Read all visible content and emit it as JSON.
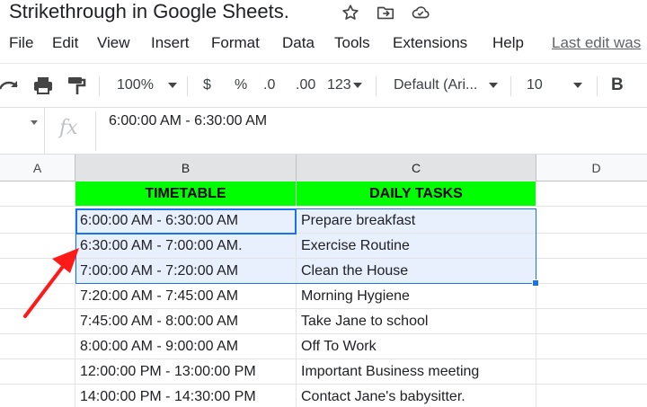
{
  "title": {
    "text": "Strikethrough in Google Sheets.",
    "icons": [
      "star-icon",
      "move-to-folder-icon",
      "cloud-saved-icon"
    ]
  },
  "menu": {
    "items": [
      "File",
      "Edit",
      "View",
      "Insert",
      "Format",
      "Data",
      "Tools",
      "Extensions",
      "Help"
    ],
    "last_edit": "Last edit was"
  },
  "toolbar": {
    "zoom": "100%",
    "currency": "$",
    "percent": "%",
    "decrease_decimal": ".0",
    "increase_decimal": ".00",
    "more_formats": "123",
    "font": "Default (Ari...",
    "font_size": "10",
    "bold": "B"
  },
  "formula_bar": {
    "fx": "fx",
    "value": "6:00:00 AM - 6:30:00 AM"
  },
  "columns": [
    "A",
    "B",
    "C",
    "D"
  ],
  "sheet": {
    "header": {
      "b": "TIMETABLE",
      "c": "DAILY TASKS"
    },
    "rows": [
      {
        "b": "6:00:00 AM - 6:30:00 AM",
        "c": "Prepare breakfast"
      },
      {
        "b": "6:30:00 AM - 7:00:00 AM.",
        "c": "Exercise Routine"
      },
      {
        "b": "7:00:00 AM - 7:20:00 AM",
        "c": "Clean the House"
      },
      {
        "b": "7:20:00 AM - 7:45:00 AM",
        "c": "Morning Hygiene"
      },
      {
        "b": "7:45:00 AM - 8:00:00 AM",
        "c": "Take Jane to school"
      },
      {
        "b": "8:00:00 AM - 9:00:00 AM",
        "c": "Off To Work"
      },
      {
        "b": "12:00:00 PM - 13:00:00 PM",
        "c": "Important Business meeting"
      },
      {
        "b": "14:00:00 PM - 14:30:00 PM",
        "c": "Contact Jane's babysitter."
      }
    ]
  },
  "colors": {
    "header_fill": "#00ff00",
    "selection": "#1a73e8",
    "selection_fill": "#e8f0fe",
    "annotation_arrow": "#ff1a1a"
  }
}
